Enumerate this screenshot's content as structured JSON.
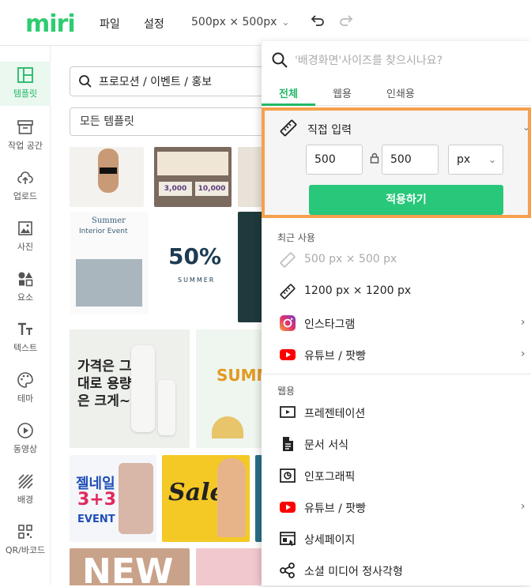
{
  "app": {
    "logo": "miri"
  },
  "topbar": {
    "file_label": "파일",
    "settings_label": "설정",
    "size_label": "500px × 500px"
  },
  "sidebar": {
    "items": [
      {
        "label": "템플릿",
        "icon": "template-icon",
        "active": true
      },
      {
        "label": "작업 공간",
        "icon": "archive-icon"
      },
      {
        "label": "업로드",
        "icon": "upload-cloud-icon"
      },
      {
        "label": "사진",
        "icon": "photo-icon"
      },
      {
        "label": "요소",
        "icon": "shapes-icon"
      },
      {
        "label": "텍스트",
        "icon": "text-icon"
      },
      {
        "label": "테마",
        "icon": "palette-icon"
      },
      {
        "label": "동영상",
        "icon": "play-icon"
      },
      {
        "label": "배경",
        "icon": "background-icon"
      },
      {
        "label": "QR/바코드",
        "icon": "qr-icon"
      }
    ]
  },
  "templates": {
    "search_value": "프로모션 / 이벤트 / 홍보",
    "filter_value": "모든 템플릿",
    "cards": {
      "sale_3000": "3,000",
      "sale_10000": "10,000",
      "summer_title": "Summer",
      "summer_sub": "Interior Event",
      "percent": "50%",
      "percent_sub": "SUMMER",
      "cosmetic_text": "가격은 그대로 용량은 크게~",
      "hello_summer": "SUMM",
      "gel_title": "젤네일",
      "gel_offer": "3+3",
      "gel_event": "EVENT",
      "sale_word": "Sale",
      "new_word": "NEW"
    }
  },
  "panel": {
    "search_placeholder": "'배경화면'사이즈를 찾으시나요?",
    "tabs": [
      "전체",
      "웹용",
      "인쇄용"
    ],
    "custom": {
      "title": "직접 입력",
      "width": "500",
      "height": "500",
      "unit": "px",
      "apply_label": "적용하기"
    },
    "recent_label": "최근 사용",
    "recent": [
      {
        "label": "500 px × 500 px",
        "muted": true,
        "icon": "ruler-icon"
      },
      {
        "label": "1200 px × 1200 px",
        "muted": false,
        "icon": "ruler-icon"
      },
      {
        "label": "인스타그램",
        "icon": "instagram-icon",
        "arrow": true
      },
      {
        "label": "유튜브 / 팟빵",
        "icon": "youtube-icon",
        "arrow": true
      }
    ],
    "web_label": "웹용",
    "web": [
      {
        "label": "프레젠테이션",
        "icon": "presentation-icon"
      },
      {
        "label": "문서 서식",
        "icon": "document-icon"
      },
      {
        "label": "인포그래픽",
        "icon": "infographic-icon"
      },
      {
        "label": "유튜브 / 팟빵",
        "icon": "youtube-icon",
        "arrow": true
      },
      {
        "label": "상세페이지",
        "icon": "detail-page-icon"
      },
      {
        "label": "소셜 미디어 정사각형",
        "icon": "share-icon"
      }
    ]
  },
  "colors": {
    "brand": "#2ecc71",
    "accent": "#22b865",
    "highlight_border": "#f6a04d",
    "apply_button": "#28c77a"
  }
}
